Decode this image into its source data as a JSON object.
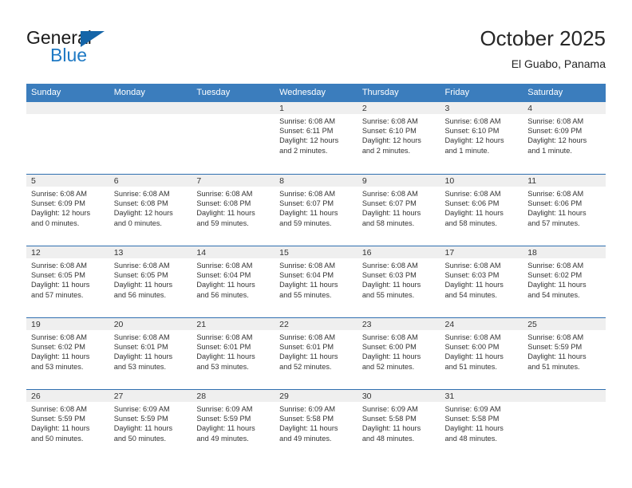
{
  "brand": {
    "name_part1": "General",
    "name_part2": "Blue",
    "triangle_icon": "blue-triangle-icon",
    "color_dark": "#1a1a1a",
    "color_blue": "#1e79c4"
  },
  "header": {
    "title": "October 2025",
    "subtitle": "El Guabo, Panama"
  },
  "theme": {
    "header_row_bg": "#3b7dbd",
    "daynum_band_bg": "#efefef",
    "cell_border": "#2f6fb0",
    "text": "#333333"
  },
  "weekday_headers": [
    "Sunday",
    "Monday",
    "Tuesday",
    "Wednesday",
    "Thursday",
    "Friday",
    "Saturday"
  ],
  "labels": {
    "sunrise": "Sunrise:",
    "sunset": "Sunset:",
    "daylight": "Daylight:"
  },
  "weeks": [
    [
      {
        "day": "",
        "sunrise": "",
        "sunset": "",
        "daylight_line1": "",
        "daylight_line2": "",
        "empty": true
      },
      {
        "day": "",
        "sunrise": "",
        "sunset": "",
        "daylight_line1": "",
        "daylight_line2": "",
        "empty": true
      },
      {
        "day": "",
        "sunrise": "",
        "sunset": "",
        "daylight_line1": "",
        "daylight_line2": "",
        "empty": true
      },
      {
        "day": "1",
        "sunrise": "Sunrise: 6:08 AM",
        "sunset": "Sunset: 6:11 PM",
        "daylight_line1": "Daylight: 12 hours",
        "daylight_line2": "and 2 minutes.",
        "empty": false
      },
      {
        "day": "2",
        "sunrise": "Sunrise: 6:08 AM",
        "sunset": "Sunset: 6:10 PM",
        "daylight_line1": "Daylight: 12 hours",
        "daylight_line2": "and 2 minutes.",
        "empty": false
      },
      {
        "day": "3",
        "sunrise": "Sunrise: 6:08 AM",
        "sunset": "Sunset: 6:10 PM",
        "daylight_line1": "Daylight: 12 hours",
        "daylight_line2": "and 1 minute.",
        "empty": false
      },
      {
        "day": "4",
        "sunrise": "Sunrise: 6:08 AM",
        "sunset": "Sunset: 6:09 PM",
        "daylight_line1": "Daylight: 12 hours",
        "daylight_line2": "and 1 minute.",
        "empty": false
      }
    ],
    [
      {
        "day": "5",
        "sunrise": "Sunrise: 6:08 AM",
        "sunset": "Sunset: 6:09 PM",
        "daylight_line1": "Daylight: 12 hours",
        "daylight_line2": "and 0 minutes.",
        "empty": false
      },
      {
        "day": "6",
        "sunrise": "Sunrise: 6:08 AM",
        "sunset": "Sunset: 6:08 PM",
        "daylight_line1": "Daylight: 12 hours",
        "daylight_line2": "and 0 minutes.",
        "empty": false
      },
      {
        "day": "7",
        "sunrise": "Sunrise: 6:08 AM",
        "sunset": "Sunset: 6:08 PM",
        "daylight_line1": "Daylight: 11 hours",
        "daylight_line2": "and 59 minutes.",
        "empty": false
      },
      {
        "day": "8",
        "sunrise": "Sunrise: 6:08 AM",
        "sunset": "Sunset: 6:07 PM",
        "daylight_line1": "Daylight: 11 hours",
        "daylight_line2": "and 59 minutes.",
        "empty": false
      },
      {
        "day": "9",
        "sunrise": "Sunrise: 6:08 AM",
        "sunset": "Sunset: 6:07 PM",
        "daylight_line1": "Daylight: 11 hours",
        "daylight_line2": "and 58 minutes.",
        "empty": false
      },
      {
        "day": "10",
        "sunrise": "Sunrise: 6:08 AM",
        "sunset": "Sunset: 6:06 PM",
        "daylight_line1": "Daylight: 11 hours",
        "daylight_line2": "and 58 minutes.",
        "empty": false
      },
      {
        "day": "11",
        "sunrise": "Sunrise: 6:08 AM",
        "sunset": "Sunset: 6:06 PM",
        "daylight_line1": "Daylight: 11 hours",
        "daylight_line2": "and 57 minutes.",
        "empty": false
      }
    ],
    [
      {
        "day": "12",
        "sunrise": "Sunrise: 6:08 AM",
        "sunset": "Sunset: 6:05 PM",
        "daylight_line1": "Daylight: 11 hours",
        "daylight_line2": "and 57 minutes.",
        "empty": false
      },
      {
        "day": "13",
        "sunrise": "Sunrise: 6:08 AM",
        "sunset": "Sunset: 6:05 PM",
        "daylight_line1": "Daylight: 11 hours",
        "daylight_line2": "and 56 minutes.",
        "empty": false
      },
      {
        "day": "14",
        "sunrise": "Sunrise: 6:08 AM",
        "sunset": "Sunset: 6:04 PM",
        "daylight_line1": "Daylight: 11 hours",
        "daylight_line2": "and 56 minutes.",
        "empty": false
      },
      {
        "day": "15",
        "sunrise": "Sunrise: 6:08 AM",
        "sunset": "Sunset: 6:04 PM",
        "daylight_line1": "Daylight: 11 hours",
        "daylight_line2": "and 55 minutes.",
        "empty": false
      },
      {
        "day": "16",
        "sunrise": "Sunrise: 6:08 AM",
        "sunset": "Sunset: 6:03 PM",
        "daylight_line1": "Daylight: 11 hours",
        "daylight_line2": "and 55 minutes.",
        "empty": false
      },
      {
        "day": "17",
        "sunrise": "Sunrise: 6:08 AM",
        "sunset": "Sunset: 6:03 PM",
        "daylight_line1": "Daylight: 11 hours",
        "daylight_line2": "and 54 minutes.",
        "empty": false
      },
      {
        "day": "18",
        "sunrise": "Sunrise: 6:08 AM",
        "sunset": "Sunset: 6:02 PM",
        "daylight_line1": "Daylight: 11 hours",
        "daylight_line2": "and 54 minutes.",
        "empty": false
      }
    ],
    [
      {
        "day": "19",
        "sunrise": "Sunrise: 6:08 AM",
        "sunset": "Sunset: 6:02 PM",
        "daylight_line1": "Daylight: 11 hours",
        "daylight_line2": "and 53 minutes.",
        "empty": false
      },
      {
        "day": "20",
        "sunrise": "Sunrise: 6:08 AM",
        "sunset": "Sunset: 6:01 PM",
        "daylight_line1": "Daylight: 11 hours",
        "daylight_line2": "and 53 minutes.",
        "empty": false
      },
      {
        "day": "21",
        "sunrise": "Sunrise: 6:08 AM",
        "sunset": "Sunset: 6:01 PM",
        "daylight_line1": "Daylight: 11 hours",
        "daylight_line2": "and 53 minutes.",
        "empty": false
      },
      {
        "day": "22",
        "sunrise": "Sunrise: 6:08 AM",
        "sunset": "Sunset: 6:01 PM",
        "daylight_line1": "Daylight: 11 hours",
        "daylight_line2": "and 52 minutes.",
        "empty": false
      },
      {
        "day": "23",
        "sunrise": "Sunrise: 6:08 AM",
        "sunset": "Sunset: 6:00 PM",
        "daylight_line1": "Daylight: 11 hours",
        "daylight_line2": "and 52 minutes.",
        "empty": false
      },
      {
        "day": "24",
        "sunrise": "Sunrise: 6:08 AM",
        "sunset": "Sunset: 6:00 PM",
        "daylight_line1": "Daylight: 11 hours",
        "daylight_line2": "and 51 minutes.",
        "empty": false
      },
      {
        "day": "25",
        "sunrise": "Sunrise: 6:08 AM",
        "sunset": "Sunset: 5:59 PM",
        "daylight_line1": "Daylight: 11 hours",
        "daylight_line2": "and 51 minutes.",
        "empty": false
      }
    ],
    [
      {
        "day": "26",
        "sunrise": "Sunrise: 6:08 AM",
        "sunset": "Sunset: 5:59 PM",
        "daylight_line1": "Daylight: 11 hours",
        "daylight_line2": "and 50 minutes.",
        "empty": false
      },
      {
        "day": "27",
        "sunrise": "Sunrise: 6:09 AM",
        "sunset": "Sunset: 5:59 PM",
        "daylight_line1": "Daylight: 11 hours",
        "daylight_line2": "and 50 minutes.",
        "empty": false
      },
      {
        "day": "28",
        "sunrise": "Sunrise: 6:09 AM",
        "sunset": "Sunset: 5:59 PM",
        "daylight_line1": "Daylight: 11 hours",
        "daylight_line2": "and 49 minutes.",
        "empty": false
      },
      {
        "day": "29",
        "sunrise": "Sunrise: 6:09 AM",
        "sunset": "Sunset: 5:58 PM",
        "daylight_line1": "Daylight: 11 hours",
        "daylight_line2": "and 49 minutes.",
        "empty": false
      },
      {
        "day": "30",
        "sunrise": "Sunrise: 6:09 AM",
        "sunset": "Sunset: 5:58 PM",
        "daylight_line1": "Daylight: 11 hours",
        "daylight_line2": "and 48 minutes.",
        "empty": false
      },
      {
        "day": "31",
        "sunrise": "Sunrise: 6:09 AM",
        "sunset": "Sunset: 5:58 PM",
        "daylight_line1": "Daylight: 11 hours",
        "daylight_line2": "and 48 minutes.",
        "empty": false
      },
      {
        "day": "",
        "sunrise": "",
        "sunset": "",
        "daylight_line1": "",
        "daylight_line2": "",
        "empty": true
      }
    ]
  ]
}
